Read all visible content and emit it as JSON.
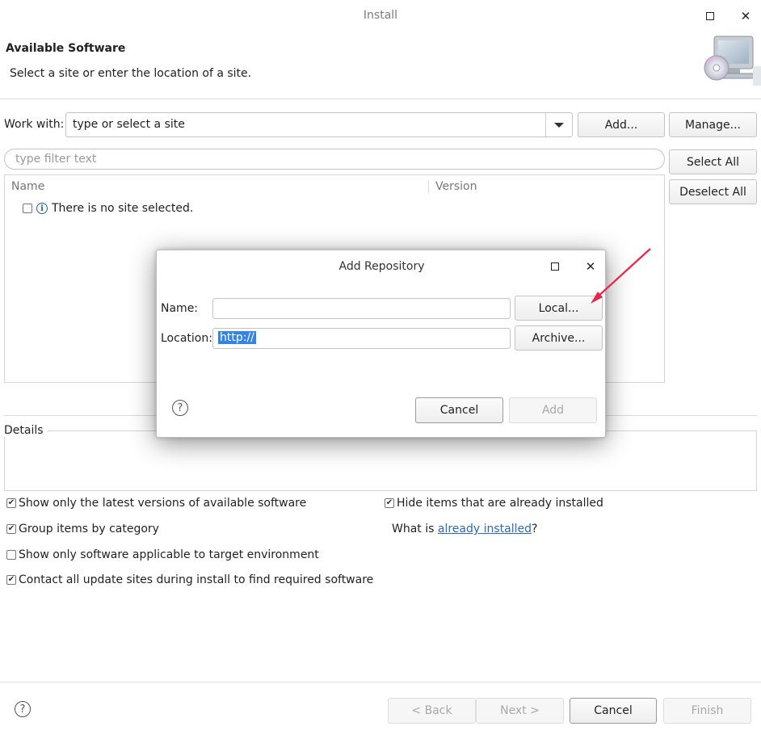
{
  "window": {
    "title": "Install"
  },
  "header": {
    "title": "Available Software",
    "description": "Select a site or enter the location of a site."
  },
  "work_with": {
    "label": "Work with:",
    "value": "type or select a site",
    "add_label": "Add...",
    "manage_label": "Manage..."
  },
  "filter": {
    "placeholder": "type filter text"
  },
  "side_buttons": {
    "select_all": "Select All",
    "deselect_all": "Deselect All"
  },
  "tree": {
    "columns": [
      "Name",
      "Version"
    ],
    "rows": [
      {
        "label": "There is no site selected.",
        "checked": false
      }
    ]
  },
  "details": {
    "label": "Details"
  },
  "options": {
    "latest_versions": {
      "label": "Show only the latest versions of available software",
      "checked": true
    },
    "group_by_category": {
      "label": "Group items by category",
      "checked": true
    },
    "target_env": {
      "label": "Show only software applicable to target environment",
      "checked": false
    },
    "contact_sites": {
      "label": "Contact all update sites during install to find required software",
      "checked": true
    },
    "hide_installed": {
      "label": "Hide items that are already installed",
      "checked": true
    },
    "what_is_prefix": "What is ",
    "what_is_link": "already installed",
    "what_is_suffix": "?"
  },
  "footer": {
    "back": "< Back",
    "next": "Next >",
    "cancel": "Cancel",
    "finish": "Finish"
  },
  "dialog": {
    "title": "Add Repository",
    "name_label": "Name:",
    "name_value": "",
    "location_label": "Location:",
    "location_value": "http://",
    "local_label": "Local...",
    "archive_label": "Archive...",
    "cancel_label": "Cancel",
    "add_label": "Add"
  },
  "colors": {
    "accent": "#3584e4",
    "link": "#2a6bbf",
    "annotation_arrow": "#e8264a"
  },
  "icons": {
    "header_graphic": "computer-cd-icon",
    "info": "info-icon",
    "help": "help-icon",
    "dropdown": "chevron-down-icon"
  }
}
